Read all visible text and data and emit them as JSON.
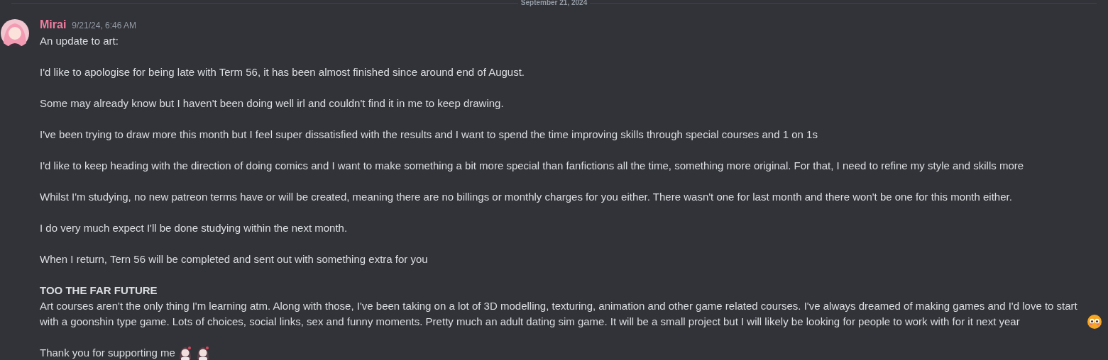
{
  "divider": {
    "date": "September 21, 2024"
  },
  "message": {
    "author": "Mirai",
    "timestamp": "9/21/24, 6:46 AM",
    "paragraphs": [
      {
        "kind": "text",
        "text": "An update to art:"
      },
      {
        "kind": "text",
        "text": "I'd like to apologise for being late with Term 56, it has been almost finished since around end of August."
      },
      {
        "kind": "text",
        "text": "Some may already know but I haven't been doing well irl and couldn't find it in me to keep drawing."
      },
      {
        "kind": "text",
        "text": "I've been trying to draw more this month but I feel super dissatisfied with the results and I want to spend the time improving skills through special courses and 1 on 1s"
      },
      {
        "kind": "text",
        "text": "I'd like to keep heading with the direction of doing comics and I want to make something a bit more special than fanfictions all the time, something more original. For that, I need to refine my style and skills more"
      },
      {
        "kind": "text",
        "text": "Whilst I'm studying, no new patreon terms have or will be created, meaning there are no billings or monthly charges for you either. There wasn't one for last month and there won't be one for this month either."
      },
      {
        "kind": "text",
        "text": "I do very much expect I'll be done studying within the next month."
      },
      {
        "kind": "text",
        "text": "When I return, Tern 56 will be completed and sent out with something extra for you"
      },
      {
        "kind": "section",
        "heading": "TOO THE FAR FUTURE",
        "text": "Art courses aren't the only thing I'm learning atm. Along with those, I've been taking on a lot of 3D modelling, texturing, animation and other game related courses. I've always dreamed of making games and I'd love to start with a goonshin type game. Lots of choices, social links, sex and funny moments. Pretty much an adult dating sim game. It will be a small project but I will likely be looking for people to work with for it next year",
        "emojis": [
          {
            "kind": "face"
          }
        ]
      },
      {
        "kind": "text",
        "text": "Thank you for supporting me",
        "emojis": [
          {
            "kind": "figure"
          },
          {
            "kind": "figure"
          }
        ]
      }
    ]
  }
}
